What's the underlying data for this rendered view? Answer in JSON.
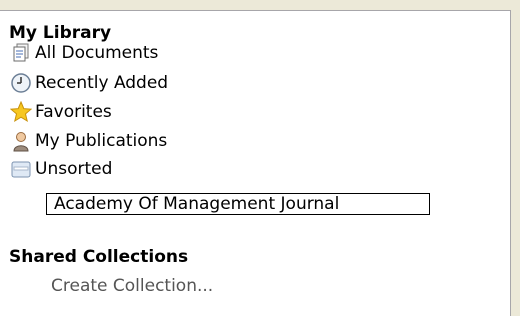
{
  "library": {
    "title": "My Library",
    "items": [
      {
        "label": "All Documents",
        "icon": "documents-icon"
      },
      {
        "label": "Recently Added",
        "icon": "clock-icon"
      },
      {
        "label": "Favorites",
        "icon": "star-icon"
      },
      {
        "label": "My Publications",
        "icon": "person-icon"
      },
      {
        "label": "Unsorted",
        "icon": "tray-icon"
      }
    ],
    "editing_value": "Academy Of Management Journal"
  },
  "shared": {
    "title": "Shared Collections",
    "create_label": "Create Collection..."
  }
}
